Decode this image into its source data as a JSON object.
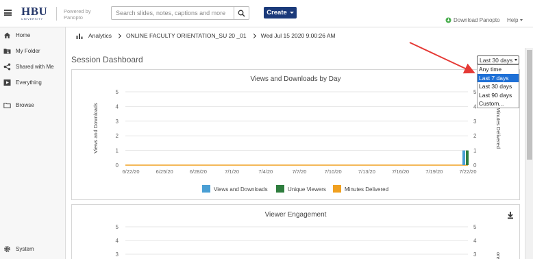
{
  "header": {
    "logo_text": "HBU",
    "logo_sub": "UNIVERSITY",
    "powered_by": "Powered by",
    "powered_brand": "Panopto",
    "search_placeholder": "Search slides, notes, captions and more",
    "create_label": "Create",
    "download_label": "Download Panopto",
    "help_label": "Help"
  },
  "sidebar": {
    "items": [
      {
        "label": "Home",
        "icon": "home-icon"
      },
      {
        "label": "My Folder",
        "icon": "folder-user-icon"
      },
      {
        "label": "Shared with Me",
        "icon": "share-icon"
      },
      {
        "label": "Everything",
        "icon": "collection-icon"
      },
      {
        "label": "Browse",
        "icon": "folder-icon"
      }
    ],
    "system_label": "System"
  },
  "breadcrumb": {
    "root": "Analytics",
    "folder": "ONLINE FACULTY ORIENTATION_SU 20 _01",
    "session": "Wed Jul 15 2020 9:00:26 AM"
  },
  "page": {
    "title": "Session Dashboard",
    "range_selected": "Last 30 days",
    "range_options": [
      "Any time",
      "Last 7 days",
      "Last 30 days",
      "Last 90 days",
      "Custom..."
    ],
    "highlighted_option": "Last 7 days"
  },
  "chart_data": [
    {
      "type": "bar",
      "title": "Views and Downloads by Day",
      "ylabel": "Views and Downloads",
      "y2label": "Minutes Delivered",
      "ylim": [
        0,
        5
      ],
      "y2lim": [
        0,
        5
      ],
      "yticks": [
        0,
        1,
        2,
        3,
        4,
        5
      ],
      "x_tick_labels": [
        "6/22/20",
        "6/25/20",
        "6/28/20",
        "7/1/20",
        "7/4/20",
        "7/7/20",
        "7/10/20",
        "7/13/20",
        "7/16/20",
        "7/19/20",
        "7/22/20"
      ],
      "categories": [
        "7/22/20"
      ],
      "series": [
        {
          "name": "Views and Downloads",
          "color": "#4a9fd4",
          "values": [
            1
          ]
        },
        {
          "name": "Unique Viewers",
          "color": "#2e7d3e",
          "values": [
            1
          ]
        },
        {
          "name": "Minutes Delivered",
          "color": "#f0a020",
          "values": [
            0
          ]
        }
      ],
      "legend": "bottom"
    },
    {
      "type": "bar",
      "title": "Viewer Engagement",
      "ylim": [
        0,
        5
      ],
      "yticks": [
        3,
        4,
        5
      ],
      "y2label": "ons"
    }
  ]
}
